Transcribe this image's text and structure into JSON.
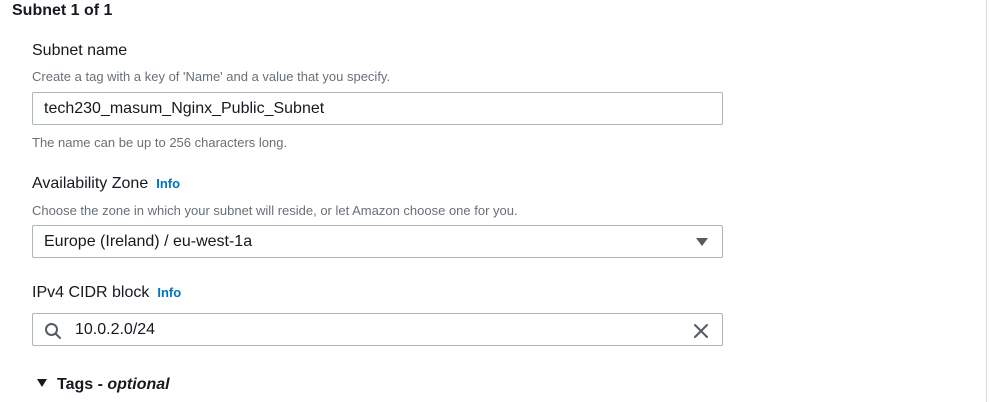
{
  "section": {
    "title": "Subnet 1 of 1"
  },
  "subnet_name": {
    "label": "Subnet name",
    "description": "Create a tag with a key of 'Name' and a value that you specify.",
    "value": "tech230_masum_Nginx_Public_Subnet",
    "constraint": "The name can be up to 256 characters long."
  },
  "availability_zone": {
    "label": "Availability Zone",
    "info": "Info",
    "description": "Choose the zone in which your subnet will reside, or let Amazon choose one for you.",
    "selected": "Europe (Ireland) / eu-west-1a",
    "icon": "caret-down-icon"
  },
  "cidr": {
    "label": "IPv4 CIDR block",
    "info": "Info",
    "value": "10.0.2.0/24",
    "icons": [
      "search-icon",
      "clear-icon"
    ]
  },
  "tags": {
    "label": "Tags",
    "separator": " - ",
    "optional": "optional",
    "expanded": false
  },
  "colors": {
    "link": "#0073bb",
    "border": "#aab7b8",
    "text": "#16191f",
    "muted": "#687078"
  }
}
